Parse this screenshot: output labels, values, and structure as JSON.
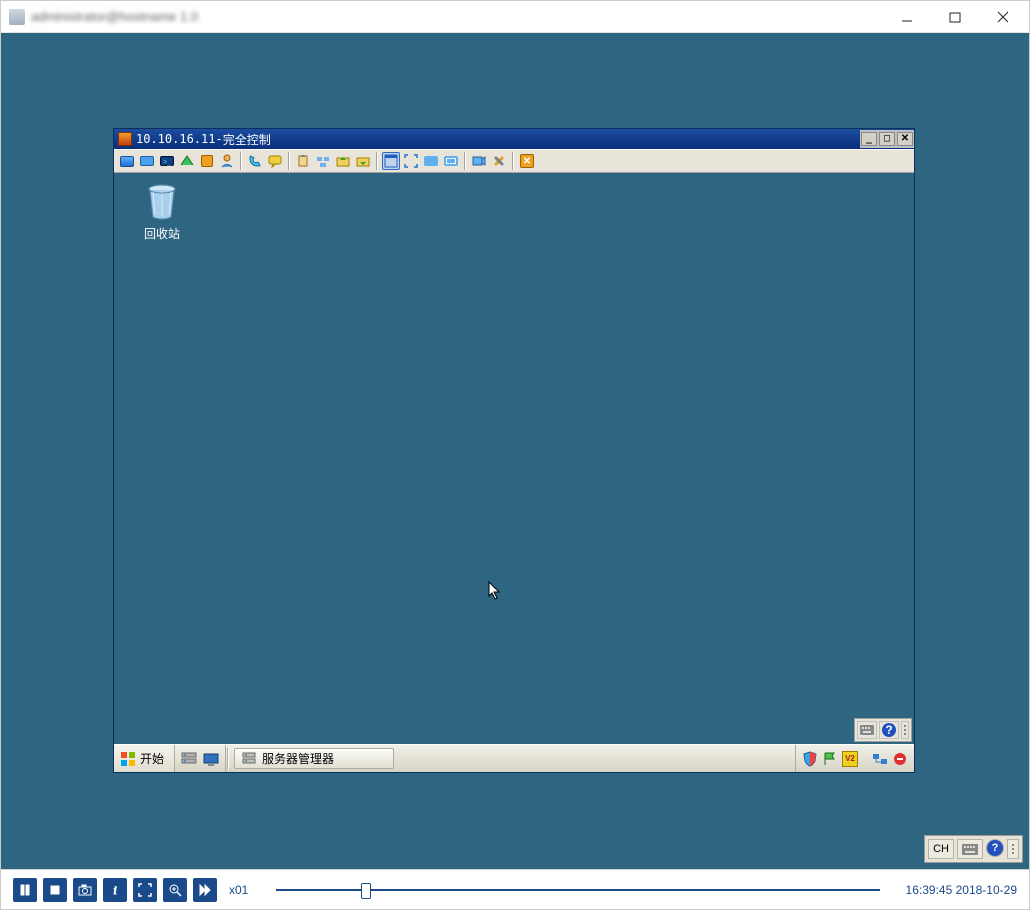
{
  "app": {
    "title": "administrator@hostname 1.0"
  },
  "remote": {
    "ip": "10.10.16.11",
    "sep": " - ",
    "mode": "完全控制",
    "recycle_bin": "回收站",
    "start": "开始",
    "task_label": "服务器管理器"
  },
  "overlay": {
    "ch": "CH"
  },
  "controls": {
    "speed": "x01",
    "time": "16:39:45",
    "date": "2018-10-29",
    "slider_pos_pct": 14
  }
}
